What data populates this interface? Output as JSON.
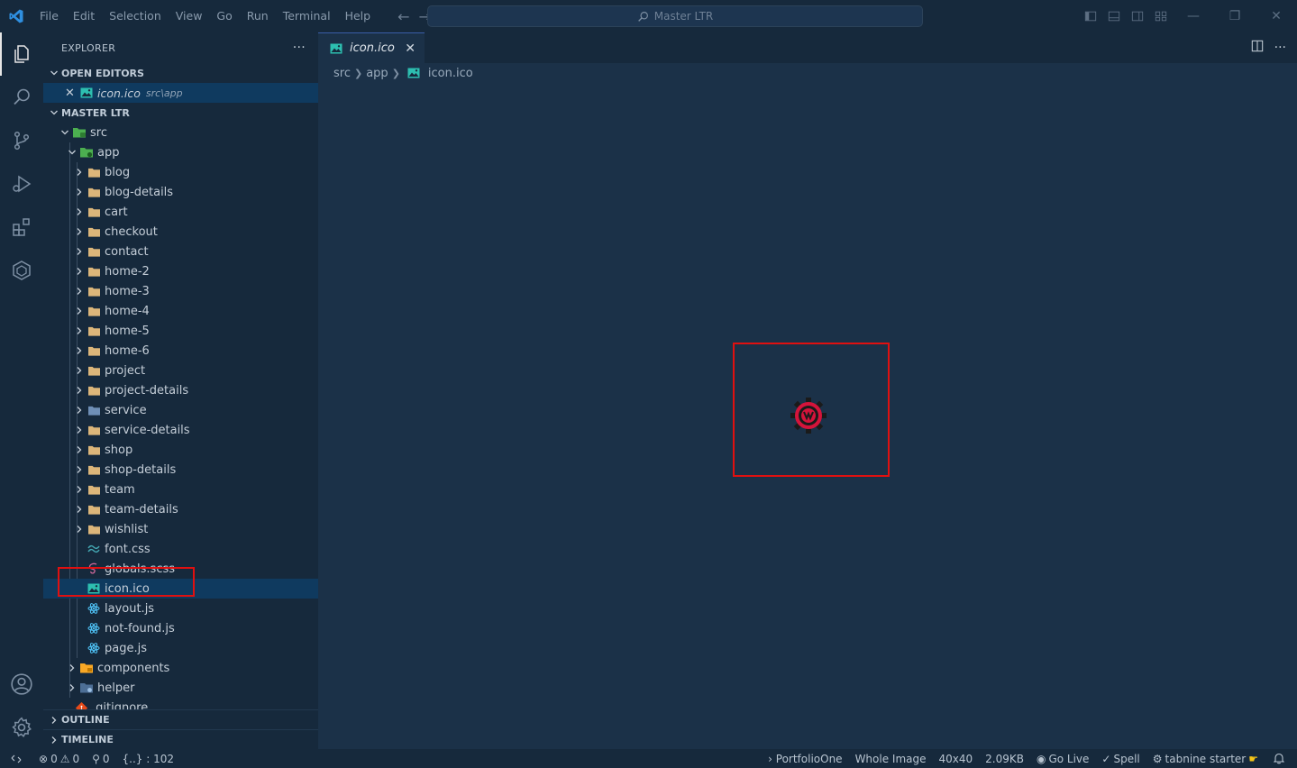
{
  "menu": [
    "File",
    "Edit",
    "Selection",
    "View",
    "Go",
    "Run",
    "Terminal",
    "Help"
  ],
  "command_center": {
    "label": "Master LTR"
  },
  "explorer": {
    "title": "EXPLORER",
    "more": "···",
    "open_editors_label": "OPEN EDITORS",
    "open_editor": {
      "name": "icon.ico",
      "path": "src\\app"
    },
    "workspace_label": "MASTER LTR"
  },
  "tree": {
    "src": "src",
    "app": "app",
    "folders": [
      "blog",
      "blog-details",
      "cart",
      "checkout",
      "contact",
      "home-2",
      "home-3",
      "home-4",
      "home-5",
      "home-6",
      "project",
      "project-details",
      "service",
      "service-details",
      "shop",
      "shop-details",
      "team",
      "team-details",
      "wishlist"
    ],
    "files": [
      "font.css",
      "globals.scss",
      "icon.ico",
      "layout.js",
      "not-found.js",
      "page.js"
    ],
    "components": "components",
    "helper": "helper",
    "gitignore": ".gitignore"
  },
  "sections": {
    "outline": "OUTLINE",
    "timeline": "TIMELINE"
  },
  "editor": {
    "tab": "icon.ico",
    "breadcrumb": [
      "src",
      "app",
      "icon.ico"
    ]
  },
  "status": {
    "errors": "0",
    "warnings": "0",
    "ports": "0",
    "json": "{..} : 102",
    "project": "› PortfolioOne",
    "zoom": "Whole Image",
    "dimensions": "40x40",
    "size": "2.09KB",
    "golive": "Go Live",
    "spell": "Spell",
    "tabnine": "tabnine starter"
  },
  "colors": {
    "accent": "#3a5ea8",
    "highlight": "#e01010",
    "folder": "#dcb67a"
  }
}
